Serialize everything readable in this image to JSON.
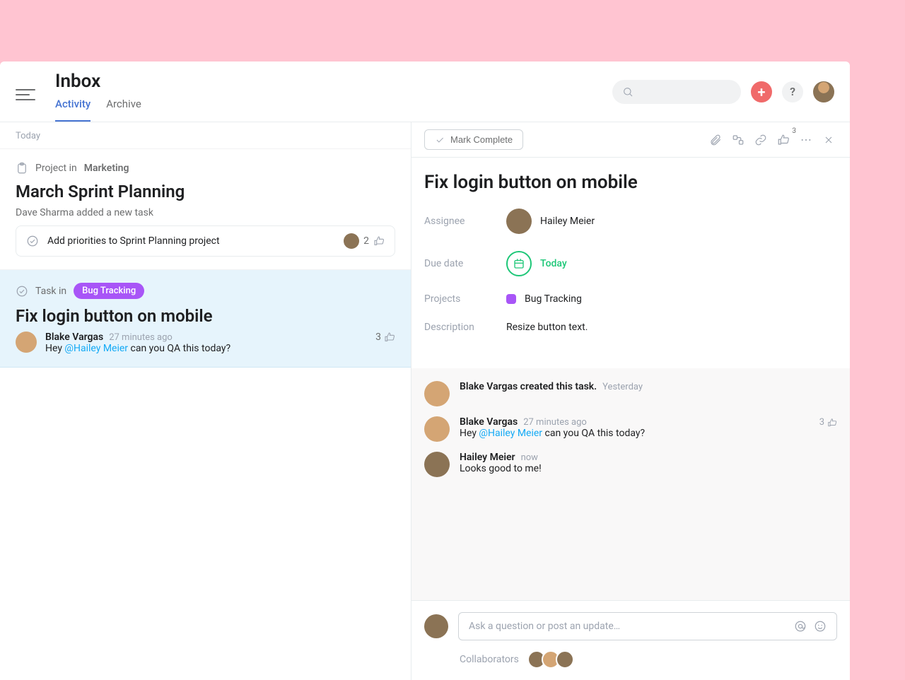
{
  "header": {
    "title": "Inbox",
    "tabs": {
      "activity": "Activity",
      "archive": "Archive"
    }
  },
  "left": {
    "section_today": "Today",
    "card1": {
      "meta_prefix": "Project in",
      "meta_project": "Marketing",
      "title": "March Sprint Planning",
      "subtitle": "Dave Sharma added a new task",
      "task_chip": "Add priorities to Sprint Planning project",
      "task_likes": "2"
    },
    "card2": {
      "meta_prefix": "Task in",
      "project_pill": "Bug Tracking",
      "title": "Fix login button on mobile",
      "commenter": "Blake Vargas",
      "time": "27 minutes ago",
      "comment_before": "Hey ",
      "comment_mention": "@Hailey Meier",
      "comment_after": " can you QA this today?",
      "likes": "3"
    }
  },
  "detail": {
    "toolbar": {
      "mark_complete": "Mark Complete",
      "like_count": "3"
    },
    "title": "Fix login button on mobile",
    "fields": {
      "assignee_label": "Assignee",
      "assignee_value": "Hailey Meier",
      "due_label": "Due date",
      "due_value": "Today",
      "projects_label": "Projects",
      "projects_value": "Bug Tracking",
      "description_label": "Description",
      "description_value": "Resize button text."
    },
    "activity": {
      "e1_text": "Blake Vargas created this task.",
      "e1_time": "Yesterday",
      "e2_name": "Blake Vargas",
      "e2_time": "27 minutes ago",
      "e2_before": "Hey ",
      "e2_mention": "@Hailey Meier",
      "e2_after": " can you QA this today?",
      "e2_likes": "3",
      "e3_name": "Hailey Meier",
      "e3_time": "now",
      "e3_text": "Looks good to me!"
    },
    "composer": {
      "placeholder": "Ask a question or post an update…",
      "collaborators_label": "Collaborators"
    }
  }
}
